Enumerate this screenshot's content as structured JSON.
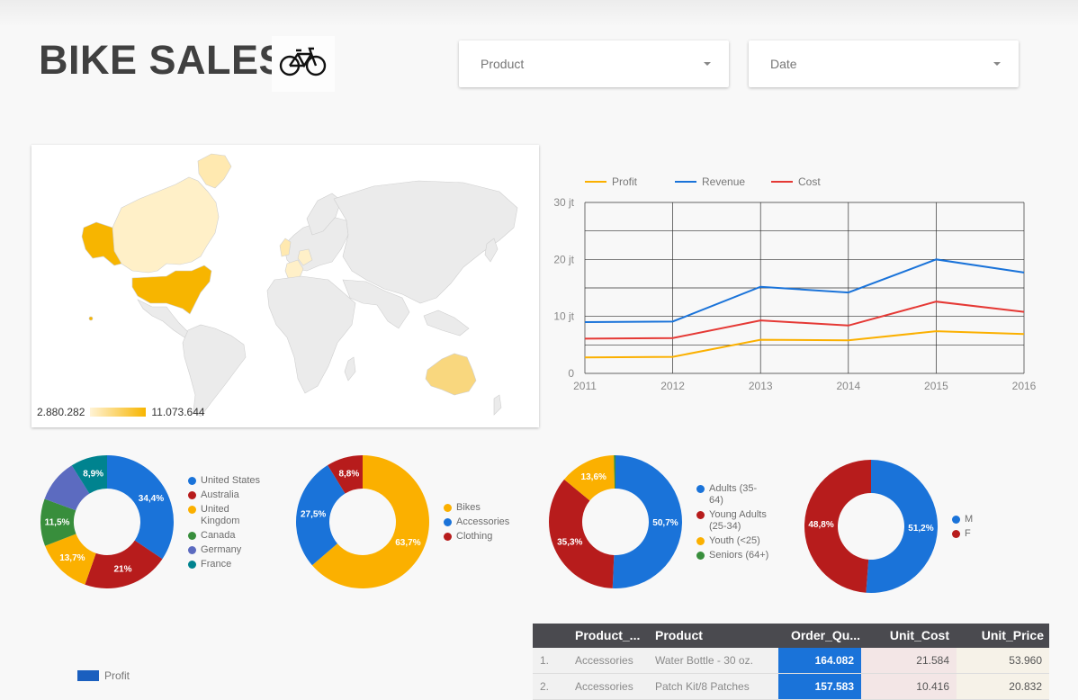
{
  "header": {
    "title": "BIKE SALES"
  },
  "filters": {
    "product_label": "Product",
    "date_label": "Date"
  },
  "map": {
    "legend_min": "2.880.282",
    "legend_max": "11.073.644"
  },
  "colors": {
    "blue": "#1a73d9",
    "red": "#b71c1c",
    "yellow": "#fbb000",
    "green": "#388e3c",
    "purple": "#5c6bc0",
    "teal": "#00838f",
    "line_red": "#e53935",
    "map_high": "#f7b500",
    "map_low": "#ffe9b0"
  },
  "chart_data": [
    {
      "type": "line",
      "x": [
        2011,
        2012,
        2013,
        2014,
        2015,
        2016
      ],
      "series": [
        {
          "name": "Profit",
          "color": "#fbb000",
          "values": [
            2.8,
            2.9,
            5.9,
            5.8,
            7.4,
            6.9
          ]
        },
        {
          "name": "Revenue",
          "color": "#1a73d9",
          "values": [
            9.0,
            9.1,
            15.2,
            14.2,
            20.0,
            17.7
          ]
        },
        {
          "name": "Cost",
          "color": "#e53935",
          "values": [
            6.1,
            6.2,
            9.3,
            8.4,
            12.6,
            10.8
          ]
        }
      ],
      "yticks": [
        "0",
        "10 jt",
        "20 jt",
        "30 jt"
      ],
      "ylim": [
        0,
        30
      ],
      "grid": true,
      "legend": "top-left"
    },
    {
      "type": "pie",
      "labels": [
        "United States",
        "Australia",
        "United Kingdom",
        "Canada",
        "Germany",
        "France"
      ],
      "values": [
        34.4,
        21,
        13.7,
        11.5,
        10.5,
        8.9
      ],
      "label_texts": [
        "34,4%",
        "21%",
        "13,7%",
        "11,5%",
        "",
        "8,9%"
      ],
      "colors": [
        "#1a73d9",
        "#b71c1c",
        "#fbb000",
        "#388e3c",
        "#5c6bc0",
        "#00838f"
      ]
    },
    {
      "type": "pie",
      "labels": [
        "Bikes",
        "Accessories",
        "Clothing"
      ],
      "values": [
        63.7,
        27.5,
        8.8
      ],
      "label_texts": [
        "63,7%",
        "27,5%",
        "8,8%"
      ],
      "colors": [
        "#fbb000",
        "#1a73d9",
        "#b71c1c"
      ]
    },
    {
      "type": "pie",
      "labels": [
        "Adults (35-64)",
        "Young Adults (25-34)",
        "Youth (<25)",
        "Seniors (64+)"
      ],
      "values": [
        50.7,
        35.3,
        13.6,
        0.4
      ],
      "label_texts": [
        "50,7%",
        "35,3%",
        "13,6%",
        ""
      ],
      "colors": [
        "#1a73d9",
        "#b71c1c",
        "#fbb000",
        "#388e3c"
      ]
    },
    {
      "type": "pie",
      "labels": [
        "M",
        "F"
      ],
      "values": [
        51.2,
        48.8
      ],
      "label_texts": [
        "51,2%",
        "48,8%"
      ],
      "colors": [
        "#1a73d9",
        "#b71c1c"
      ]
    }
  ],
  "table": {
    "headers": [
      "Product_...",
      "Product",
      "Order_Qu...",
      "Unit_Cost",
      "Unit_Price"
    ],
    "rows": [
      {
        "idx": "1.",
        "category": "Accessories",
        "product": "Water Bottle - 30 oz.",
        "qty": "164.082",
        "cost": "21.584",
        "price": "53.960"
      },
      {
        "idx": "2.",
        "category": "Accessories",
        "product": "Patch Kit/8 Patches",
        "qty": "157.583",
        "cost": "10.416",
        "price": "20.832"
      }
    ]
  },
  "profit_legend": "Profit"
}
